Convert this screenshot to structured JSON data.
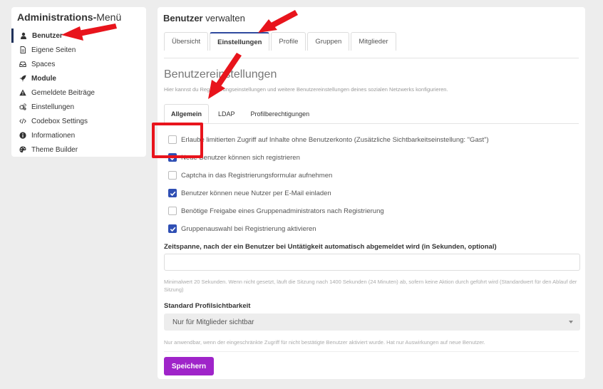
{
  "sidebar": {
    "title_bold": "Administrations-",
    "title_rest": "Menü",
    "items": [
      {
        "label": "Benutzer",
        "icon": "user-icon"
      },
      {
        "label": "Eigene Seiten",
        "icon": "file-icon"
      },
      {
        "label": "Spaces",
        "icon": "inbox-icon"
      },
      {
        "label": "Module",
        "icon": "rocket-icon"
      },
      {
        "label": "Gemeldete Beiträge",
        "icon": "warning-icon"
      },
      {
        "label": "Einstellungen",
        "icon": "cogs-icon"
      },
      {
        "label": "Codebox Settings",
        "icon": "code-icon"
      },
      {
        "label": "Informationen",
        "icon": "info-icon"
      },
      {
        "label": "Theme Builder",
        "icon": "palette-icon"
      }
    ]
  },
  "main": {
    "title_bold": "Benutzer",
    "title_rest": " verwalten",
    "tabs": [
      "Übersicht",
      "Einstellungen",
      "Profile",
      "Gruppen",
      "Mitglieder"
    ],
    "section_title": "Benutzereinstellungen",
    "section_desc": "Hier kannst du Registrierungseinstellungen und weitere Benutzereinstellungen deines sozialen Netzwerks konfigurieren.",
    "subtabs": [
      "Allgemein",
      "LDAP",
      "Profilberechtigungen"
    ],
    "checkboxes": [
      {
        "label": "Erlaube limitierten Zugriff auf Inhalte ohne Benutzerkonto (Zusätzliche Sichtbarkeitseinstellung: \"Gast\")",
        "checked": false
      },
      {
        "label": "Neue Benutzer können sich registrieren",
        "checked": true
      },
      {
        "label": "Captcha in das Registrierungsformular aufnehmen",
        "checked": false
      },
      {
        "label": "Benutzer können neue Nutzer per E-Mail einladen",
        "checked": true
      },
      {
        "label": "Benötige Freigabe eines Gruppenadministrators nach Registrierung",
        "checked": false
      },
      {
        "label": "Gruppenauswahl bei Registrierung aktivieren",
        "checked": true
      }
    ],
    "timeout_label": "Zeitspanne, nach der ein Benutzer bei Untätigkeit automatisch abgemeldet wird (in Sekunden, optional)",
    "timeout_value": "",
    "timeout_help": "Minimalwert 20 Sekunden. Wenn nicht gesetzt, läuft die Sitzung nach 1400 Sekunden (24 Minuten) ab, sofern keine Aktion durch geführt wird (Standardwert für den Ablauf der Sitzung)",
    "visibility_label": "Standard Profilsichtbarkeit",
    "visibility_value": "Nur für Mitglieder sichtbar",
    "visibility_help": "Nur anwendbar, wenn der eingeschränkte Zugriff für nicht bestätigte Benutzer aktiviert wurde. Hat nur Auswirkungen auf neue Benutzer.",
    "save_label": "Speichern"
  },
  "colors": {
    "accent": "#9f24c9",
    "checkbox": "#2f4fb4",
    "annotation": "#e8141c"
  }
}
